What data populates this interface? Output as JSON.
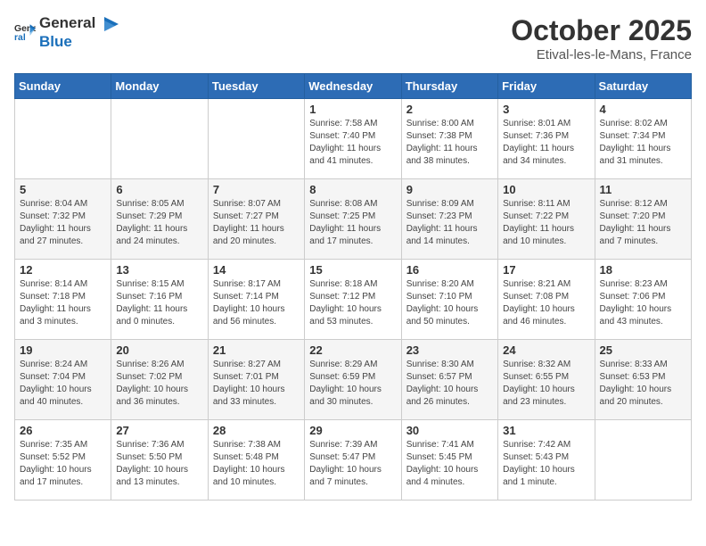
{
  "header": {
    "logo_general": "General",
    "logo_blue": "Blue",
    "month_title": "October 2025",
    "location": "Etival-les-le-Mans, France"
  },
  "weekdays": [
    "Sunday",
    "Monday",
    "Tuesday",
    "Wednesday",
    "Thursday",
    "Friday",
    "Saturday"
  ],
  "weeks": [
    [
      {
        "day": "",
        "info": ""
      },
      {
        "day": "",
        "info": ""
      },
      {
        "day": "",
        "info": ""
      },
      {
        "day": "1",
        "info": "Sunrise: 7:58 AM\nSunset: 7:40 PM\nDaylight: 11 hours and 41 minutes."
      },
      {
        "day": "2",
        "info": "Sunrise: 8:00 AM\nSunset: 7:38 PM\nDaylight: 11 hours and 38 minutes."
      },
      {
        "day": "3",
        "info": "Sunrise: 8:01 AM\nSunset: 7:36 PM\nDaylight: 11 hours and 34 minutes."
      },
      {
        "day": "4",
        "info": "Sunrise: 8:02 AM\nSunset: 7:34 PM\nDaylight: 11 hours and 31 minutes."
      }
    ],
    [
      {
        "day": "5",
        "info": "Sunrise: 8:04 AM\nSunset: 7:32 PM\nDaylight: 11 hours and 27 minutes."
      },
      {
        "day": "6",
        "info": "Sunrise: 8:05 AM\nSunset: 7:29 PM\nDaylight: 11 hours and 24 minutes."
      },
      {
        "day": "7",
        "info": "Sunrise: 8:07 AM\nSunset: 7:27 PM\nDaylight: 11 hours and 20 minutes."
      },
      {
        "day": "8",
        "info": "Sunrise: 8:08 AM\nSunset: 7:25 PM\nDaylight: 11 hours and 17 minutes."
      },
      {
        "day": "9",
        "info": "Sunrise: 8:09 AM\nSunset: 7:23 PM\nDaylight: 11 hours and 14 minutes."
      },
      {
        "day": "10",
        "info": "Sunrise: 8:11 AM\nSunset: 7:22 PM\nDaylight: 11 hours and 10 minutes."
      },
      {
        "day": "11",
        "info": "Sunrise: 8:12 AM\nSunset: 7:20 PM\nDaylight: 11 hours and 7 minutes."
      }
    ],
    [
      {
        "day": "12",
        "info": "Sunrise: 8:14 AM\nSunset: 7:18 PM\nDaylight: 11 hours and 3 minutes."
      },
      {
        "day": "13",
        "info": "Sunrise: 8:15 AM\nSunset: 7:16 PM\nDaylight: 11 hours and 0 minutes."
      },
      {
        "day": "14",
        "info": "Sunrise: 8:17 AM\nSunset: 7:14 PM\nDaylight: 10 hours and 56 minutes."
      },
      {
        "day": "15",
        "info": "Sunrise: 8:18 AM\nSunset: 7:12 PM\nDaylight: 10 hours and 53 minutes."
      },
      {
        "day": "16",
        "info": "Sunrise: 8:20 AM\nSunset: 7:10 PM\nDaylight: 10 hours and 50 minutes."
      },
      {
        "day": "17",
        "info": "Sunrise: 8:21 AM\nSunset: 7:08 PM\nDaylight: 10 hours and 46 minutes."
      },
      {
        "day": "18",
        "info": "Sunrise: 8:23 AM\nSunset: 7:06 PM\nDaylight: 10 hours and 43 minutes."
      }
    ],
    [
      {
        "day": "19",
        "info": "Sunrise: 8:24 AM\nSunset: 7:04 PM\nDaylight: 10 hours and 40 minutes."
      },
      {
        "day": "20",
        "info": "Sunrise: 8:26 AM\nSunset: 7:02 PM\nDaylight: 10 hours and 36 minutes."
      },
      {
        "day": "21",
        "info": "Sunrise: 8:27 AM\nSunset: 7:01 PM\nDaylight: 10 hours and 33 minutes."
      },
      {
        "day": "22",
        "info": "Sunrise: 8:29 AM\nSunset: 6:59 PM\nDaylight: 10 hours and 30 minutes."
      },
      {
        "day": "23",
        "info": "Sunrise: 8:30 AM\nSunset: 6:57 PM\nDaylight: 10 hours and 26 minutes."
      },
      {
        "day": "24",
        "info": "Sunrise: 8:32 AM\nSunset: 6:55 PM\nDaylight: 10 hours and 23 minutes."
      },
      {
        "day": "25",
        "info": "Sunrise: 8:33 AM\nSunset: 6:53 PM\nDaylight: 10 hours and 20 minutes."
      }
    ],
    [
      {
        "day": "26",
        "info": "Sunrise: 7:35 AM\nSunset: 5:52 PM\nDaylight: 10 hours and 17 minutes."
      },
      {
        "day": "27",
        "info": "Sunrise: 7:36 AM\nSunset: 5:50 PM\nDaylight: 10 hours and 13 minutes."
      },
      {
        "day": "28",
        "info": "Sunrise: 7:38 AM\nSunset: 5:48 PM\nDaylight: 10 hours and 10 minutes."
      },
      {
        "day": "29",
        "info": "Sunrise: 7:39 AM\nSunset: 5:47 PM\nDaylight: 10 hours and 7 minutes."
      },
      {
        "day": "30",
        "info": "Sunrise: 7:41 AM\nSunset: 5:45 PM\nDaylight: 10 hours and 4 minutes."
      },
      {
        "day": "31",
        "info": "Sunrise: 7:42 AM\nSunset: 5:43 PM\nDaylight: 10 hours and 1 minute."
      },
      {
        "day": "",
        "info": ""
      }
    ]
  ]
}
